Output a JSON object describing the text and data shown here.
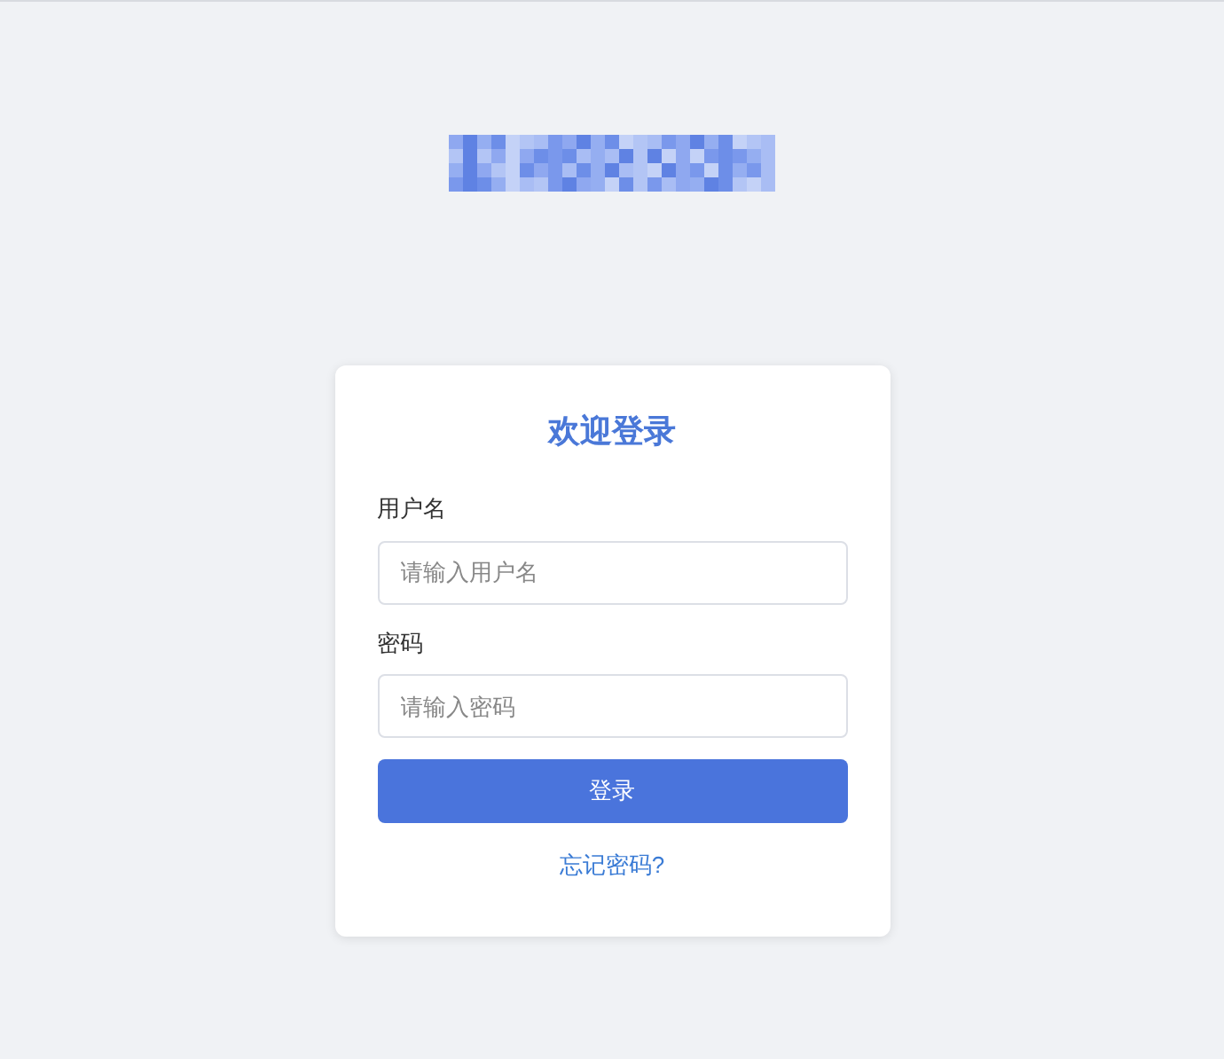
{
  "login_card": {
    "title": "欢迎登录",
    "fields": [
      {
        "label": "用户名",
        "placeholder": "请输入用户名"
      },
      {
        "label": "密码",
        "placeholder": "请输入密码"
      }
    ],
    "submit_button": "登录",
    "forgot_link": "忘记密码?"
  }
}
